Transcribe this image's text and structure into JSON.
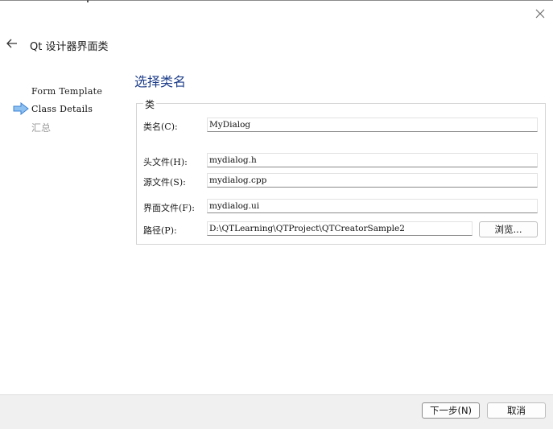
{
  "window": {
    "title": "Qt 设计器界面类"
  },
  "steps": [
    {
      "label": "Form Template",
      "state": "done"
    },
    {
      "label": "Class Details",
      "state": "current"
    },
    {
      "label": "汇总",
      "state": "pending"
    }
  ],
  "page": {
    "heading": "选择类名",
    "group_title": "类"
  },
  "form": {
    "class_name": {
      "label": "类名(C):",
      "value": "MyDialog"
    },
    "header_file": {
      "label": "头文件(H):",
      "value": "mydialog.h"
    },
    "source_file": {
      "label": "源文件(S):",
      "value": "mydialog.cpp"
    },
    "ui_file": {
      "label": "界面文件(F):",
      "value": "mydialog.ui"
    },
    "path": {
      "label": "路径(P):",
      "value": "D:\\QTLearning\\QTProject\\QTCreatorSample2"
    },
    "browse_label": "浏览..."
  },
  "footer": {
    "next_label": "下一步(N)",
    "cancel_label": "取消"
  },
  "colors": {
    "heading": "#1f3f8a",
    "step_pending": "#9a9a9a",
    "arrow": "#3b82d6",
    "footer_bg": "#f0f0f0"
  },
  "icons": {
    "close": "close-icon",
    "back": "arrow-left-icon",
    "current_step": "arrow-right-icon"
  }
}
